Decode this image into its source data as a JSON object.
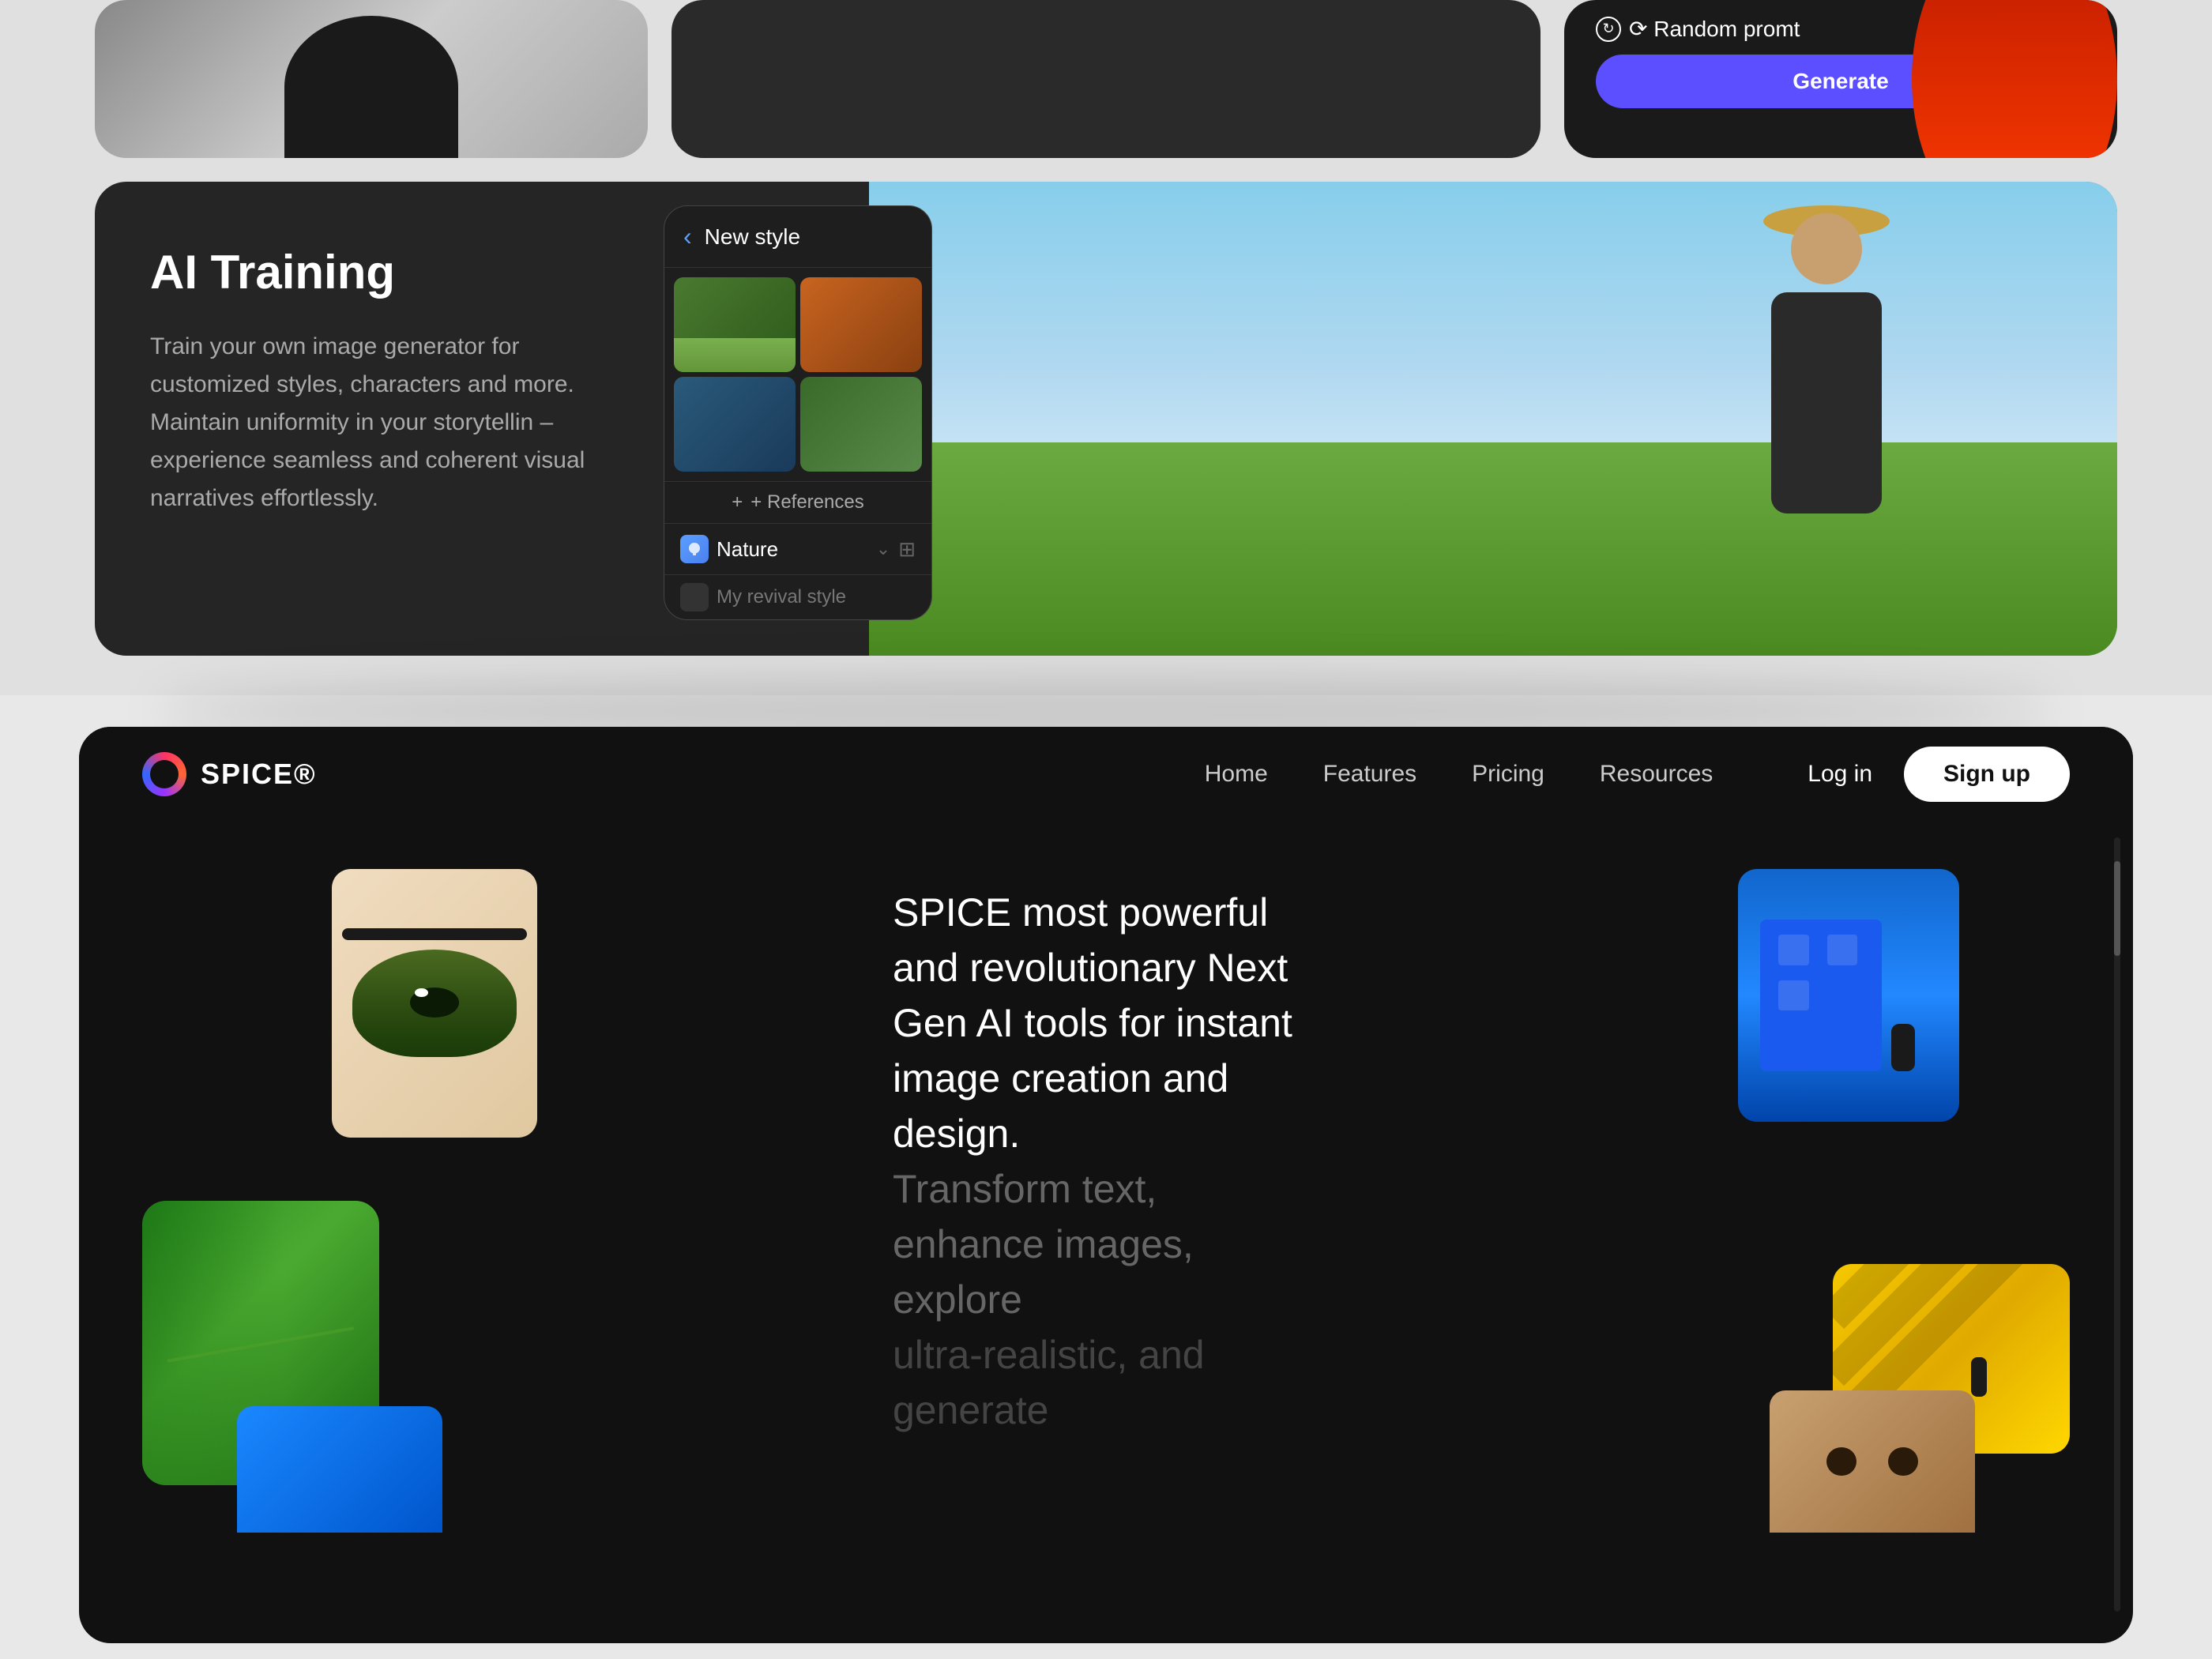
{
  "page": {
    "background_color": "#e0e0e0"
  },
  "top_section": {
    "random_promt_label": "⟳ Random promt",
    "generate_btn_label": "Generate",
    "ai_training": {
      "title": "AI Training",
      "description": "Train your own image generator for customized styles, characters and more. Maintain uniformity in your storytellin – experience seamless and coherent visual narratives effortlessly."
    },
    "phone_ui": {
      "header": "New style",
      "back_label": "‹",
      "refs_label": "+ References",
      "nature_label": "Nature",
      "revival_label": "My revival style"
    }
  },
  "navbar": {
    "logo_text": "SPICE®",
    "nav_items": [
      {
        "label": "Home",
        "id": "home"
      },
      {
        "label": "Features",
        "id": "features"
      },
      {
        "label": "Pricing",
        "id": "pricing"
      },
      {
        "label": "Resources",
        "id": "resources"
      }
    ],
    "login_label": "Log in",
    "signup_label": "Sign up"
  },
  "hero": {
    "title_part1": "SPICE most powerful and revolutionary Next Gen AI tools for instant image creation and design.",
    "title_part2": "Transform text, enhance images, explore",
    "title_part3": "ultra-realistic, and generate"
  }
}
